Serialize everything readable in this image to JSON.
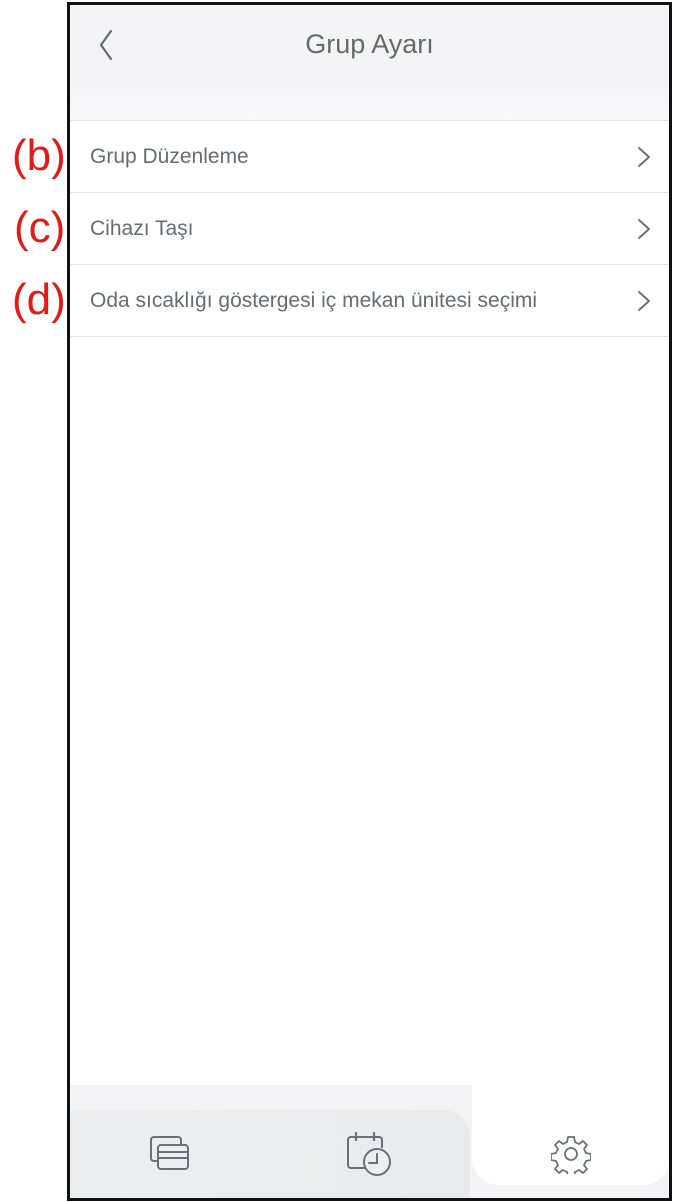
{
  "header": {
    "title": "Grup Ayarı",
    "back_icon": "chevron-left-icon"
  },
  "menu": {
    "items": [
      {
        "label": "Grup Düzenleme",
        "annotation": "(b)"
      },
      {
        "label": "Cihazı Taşı",
        "annotation": "(c)"
      },
      {
        "label": "Oda sıcaklığı göstergesi iç mekan ünitesi seçimi",
        "annotation": "(d)"
      }
    ]
  },
  "tabbar": {
    "tabs": [
      {
        "icon": "devices-icon",
        "active": false
      },
      {
        "icon": "schedule-icon",
        "active": false
      },
      {
        "icon": "gear-icon",
        "active": true
      }
    ]
  },
  "colors": {
    "annotation": "#e21a1a",
    "text": "#686c72",
    "background": "#f4f4f6"
  }
}
